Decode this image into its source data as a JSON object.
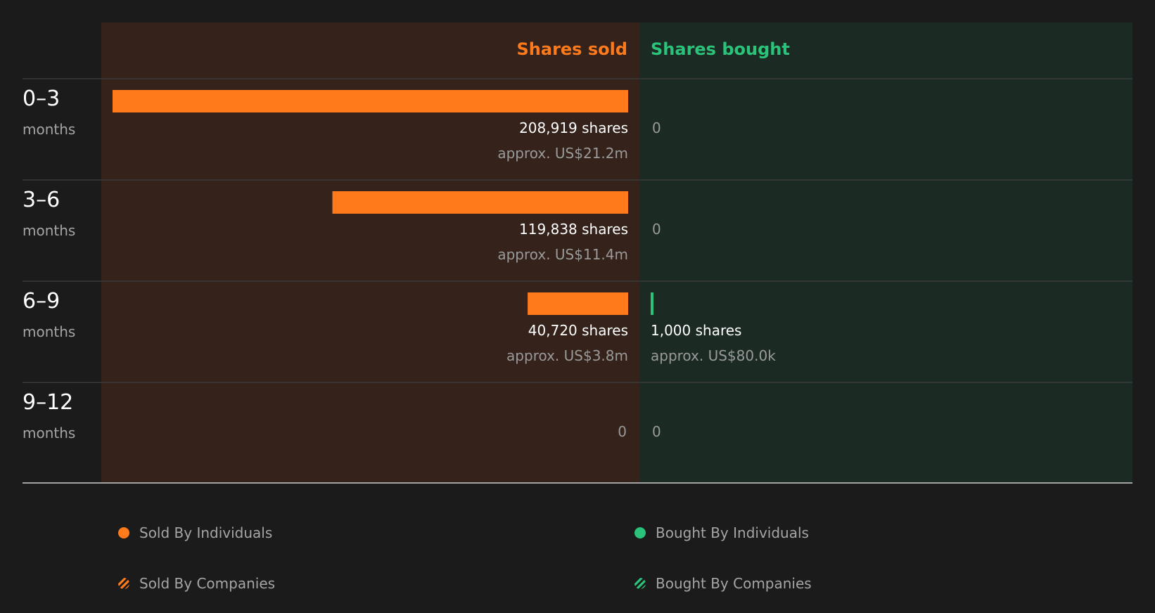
{
  "colors": {
    "sold": "#ff7a1a",
    "bought": "#2bc27a",
    "sold_bg": "#34221b",
    "bought_bg": "#1c2a24"
  },
  "headers": {
    "sold": "Shares sold",
    "bought": "Shares bought"
  },
  "chart_data": {
    "type": "bar",
    "categories": [
      "0–3",
      "3–6",
      "6–9",
      "9–12"
    ],
    "category_unit": "months",
    "series": [
      {
        "name": "Shares sold",
        "values": [
          208919,
          119838,
          40720,
          0
        ],
        "labels": [
          "208,919 shares",
          "119,838 shares",
          "40,720 shares",
          "0"
        ],
        "approx": [
          "approx. US$21.2m",
          "approx. US$11.4m",
          "approx. US$3.8m",
          ""
        ]
      },
      {
        "name": "Shares bought",
        "values": [
          0,
          0,
          1000,
          0
        ],
        "labels": [
          "0",
          "0",
          "1,000 shares",
          "0"
        ],
        "approx": [
          "",
          "",
          "approx. US$80.0k",
          ""
        ]
      }
    ]
  },
  "legend": {
    "sold_individuals": "Sold By Individuals",
    "bought_individuals": "Bought By Individuals",
    "sold_companies": "Sold By Companies",
    "bought_companies": "Bought By Companies"
  }
}
